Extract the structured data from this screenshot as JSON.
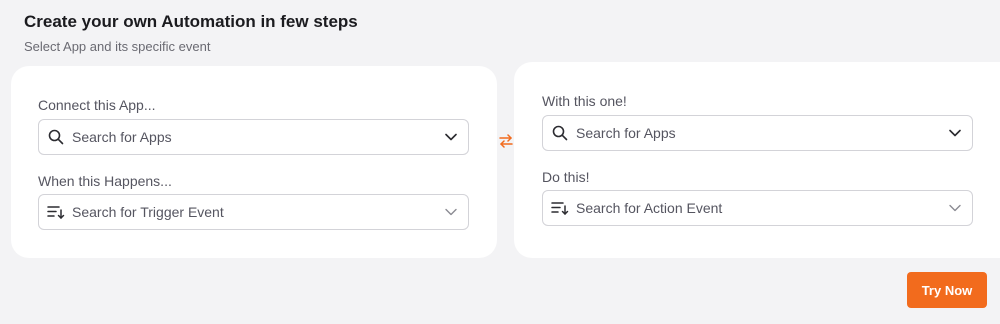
{
  "header": {
    "title": "Create your own Automation in few steps",
    "subtitle": "Select App and its specific event"
  },
  "trigger_card": {
    "app_label": "Connect this App...",
    "app_placeholder": "Search for Apps",
    "event_label": "When this Happens...",
    "event_placeholder": "Search for Trigger Event"
  },
  "action_card": {
    "app_label": "With this one!",
    "app_placeholder": "Search for Apps",
    "event_label": "Do this!",
    "event_placeholder": "Search for Action Event"
  },
  "actions": {
    "try_now_label": "Try Now"
  },
  "icons": {
    "search": "search-icon",
    "event": "sort-list-icon",
    "chevron": "chevron-down-icon",
    "swap": "swap-arrows-icon"
  },
  "colors": {
    "accent": "#f26b1d",
    "background": "#f3f3f5",
    "card": "#ffffff",
    "border": "#d3d3d8"
  }
}
